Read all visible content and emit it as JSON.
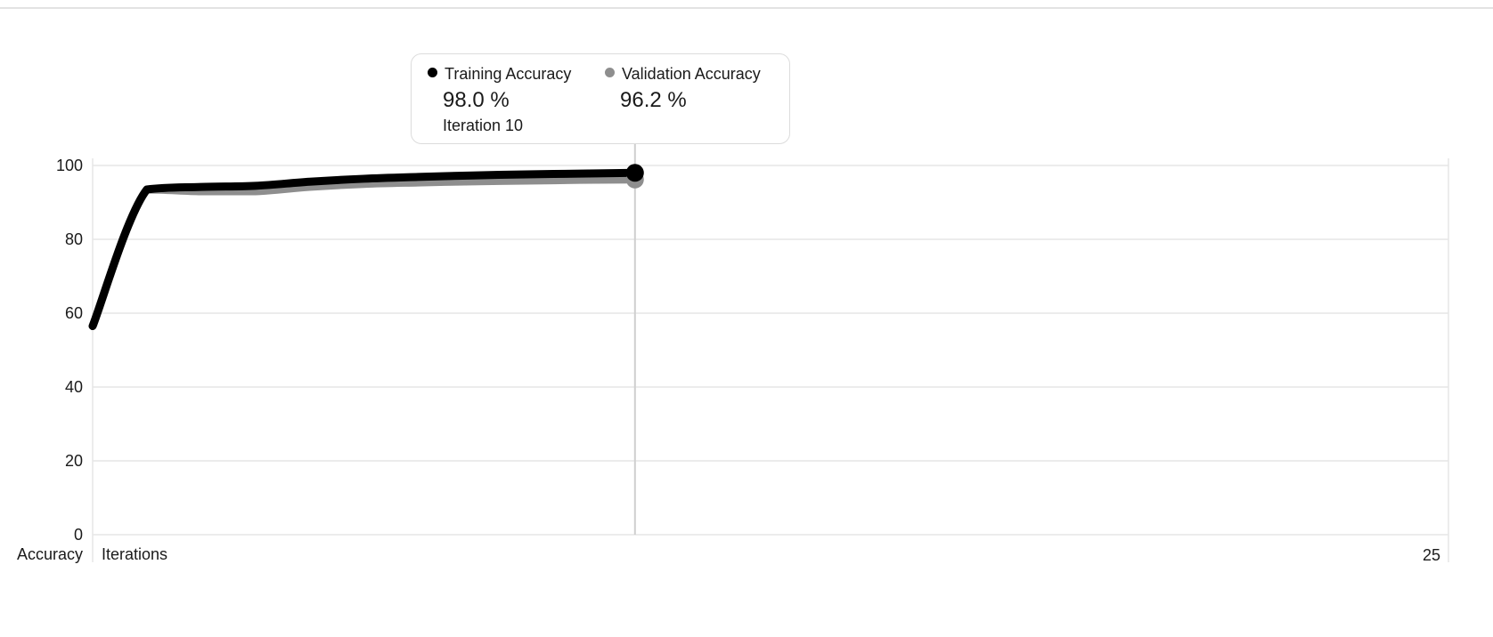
{
  "chart_data": {
    "type": "line",
    "xlabel": "Iterations",
    "ylabel": "Accuracy",
    "x_max_label": "25",
    "xlim": [
      0,
      25
    ],
    "ylim": [
      0,
      100
    ],
    "yticks": [
      0,
      20,
      40,
      60,
      80,
      100
    ],
    "grid": true,
    "x": [
      0,
      1,
      2,
      3,
      4,
      5,
      6,
      7,
      8,
      9,
      10
    ],
    "series": [
      {
        "name": "Training Accuracy",
        "color": "#000000",
        "values": [
          56.5,
          93.5,
          94.2,
          94.5,
          95.6,
          96.4,
          96.9,
          97.3,
          97.6,
          97.8,
          98.0
        ]
      },
      {
        "name": "Validation Accuracy",
        "color": "#8e8e8e",
        "values": [
          56.5,
          93.5,
          93.0,
          93.0,
          94.2,
          95.0,
          95.4,
          95.7,
          95.9,
          96.1,
          96.2
        ]
      }
    ],
    "tooltip": {
      "iteration": 10,
      "iteration_label": "Iteration 10",
      "entries": [
        {
          "name": "Training Accuracy",
          "value_label": "98.0 %",
          "color": "#000000"
        },
        {
          "name": "Validation Accuracy",
          "value_label": "96.2 %",
          "color": "#8e8e8e"
        }
      ]
    }
  }
}
